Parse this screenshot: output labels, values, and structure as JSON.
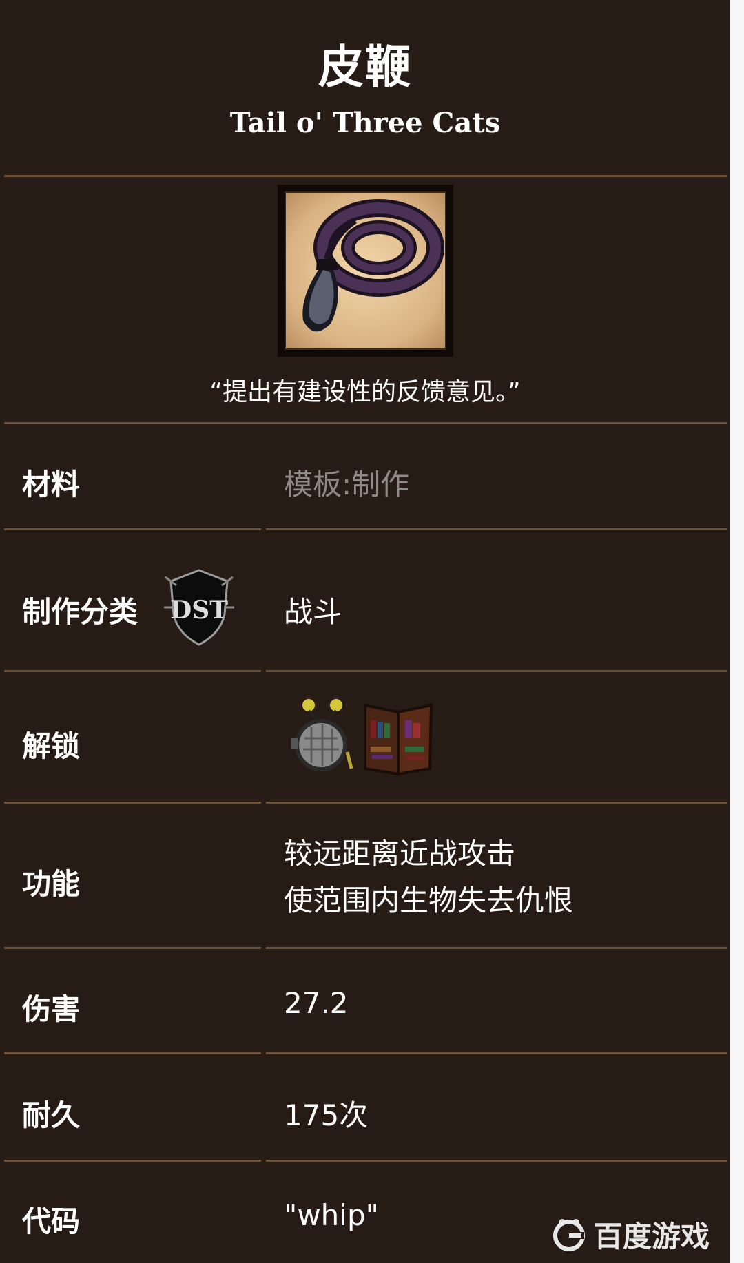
{
  "item": {
    "name_cn": "皮鞭",
    "name_en": "Tail o' Three Cats",
    "quote": "“提出有建设性的反馈意见。”"
  },
  "rows": [
    {
      "label": "材料",
      "value": "模板:制作"
    },
    {
      "label": "制作分类",
      "value": "战斗",
      "badge": "DST"
    },
    {
      "label": "解锁",
      "value": ""
    },
    {
      "label": "功能",
      "lines": [
        "较远距离近战攻击",
        "使范围内生物失去仇恨"
      ]
    },
    {
      "label": "伤害",
      "value": "27.2"
    },
    {
      "label": "耐久",
      "value": "175次"
    },
    {
      "label": "代码",
      "value": "\"whip\""
    }
  ],
  "unlock_icons": [
    "science-machine-icon",
    "bookcase-icon"
  ],
  "watermark": "百度游戏",
  "colors": {
    "background": "#271c15",
    "divider": "#6d5038",
    "text": "#ffffff",
    "muted_text": "#8e8a86"
  }
}
